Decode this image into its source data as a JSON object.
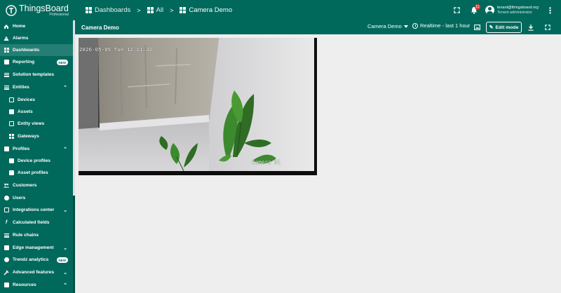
{
  "app": {
    "name": "ThingsBoard",
    "edition": "Professional"
  },
  "breadcrumb": {
    "items": [
      {
        "label": "Dashboards",
        "icon": "dashboards-icon"
      },
      {
        "label": "All",
        "icon": "dashboards-icon"
      },
      {
        "label": "Camera Demo",
        "icon": "dashboards-icon"
      }
    ],
    "separator": ">"
  },
  "topbar": {
    "notifications_count": "11",
    "user_email": "tenant@thingsboard.org",
    "user_role": "Tenant administrator"
  },
  "sidebar": {
    "items": [
      {
        "label": "Home",
        "icon": "home-icon"
      },
      {
        "label": "Alarms",
        "icon": "alarm-icon"
      },
      {
        "label": "Dashboards",
        "icon": "dashboards-icon",
        "active": true
      },
      {
        "label": "Reporting",
        "icon": "reporting-icon",
        "badge": "NEW"
      },
      {
        "label": "Solution templates",
        "icon": "solution-templates-icon"
      },
      {
        "label": "Entities",
        "icon": "entities-icon",
        "expanded": true
      },
      {
        "label": "Devices",
        "icon": "devices-icon",
        "sub": true
      },
      {
        "label": "Assets",
        "icon": "assets-icon",
        "sub": true
      },
      {
        "label": "Entity views",
        "icon": "entity-views-icon",
        "sub": true
      },
      {
        "label": "Gateways",
        "icon": "gateways-icon",
        "sub": true
      },
      {
        "label": "Profiles",
        "icon": "profiles-icon",
        "expanded": true
      },
      {
        "label": "Device profiles",
        "icon": "device-profiles-icon",
        "sub": true
      },
      {
        "label": "Asset profiles",
        "icon": "asset-profiles-icon",
        "sub": true
      },
      {
        "label": "Customers",
        "icon": "customers-icon"
      },
      {
        "label": "Users",
        "icon": "users-icon"
      },
      {
        "label": "Integrations center",
        "icon": "integrations-icon",
        "expanded": false
      },
      {
        "label": "Calculated fields",
        "icon": "calculated-fields-icon"
      },
      {
        "label": "Rule chains",
        "icon": "rule-chains-icon"
      },
      {
        "label": "Edge management",
        "icon": "edge-icon",
        "expanded": false
      },
      {
        "label": "Trendz analytics",
        "icon": "trendz-icon",
        "badge": "NEW"
      },
      {
        "label": "Advanced features",
        "icon": "advanced-features-icon",
        "expanded": false
      },
      {
        "label": "Resources",
        "icon": "resources-icon",
        "expanded": true
      }
    ]
  },
  "dashboard": {
    "title": "Camera Demo",
    "state": "Camera Demo",
    "timewindow": "Realtime - last 1 hour",
    "edit_label": "Edit mode"
  },
  "camera": {
    "timestamp": "2026-05-05 Tue 12:11:32",
    "label": "Camera 01"
  },
  "colors": {
    "primary": "#00695c",
    "background": "#eeeeee"
  }
}
